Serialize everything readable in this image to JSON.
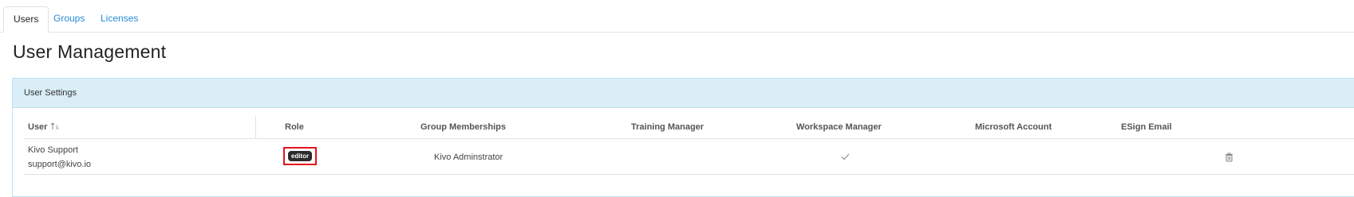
{
  "tabs": [
    {
      "label": "Users",
      "active": true
    },
    {
      "label": "Groups",
      "active": false
    },
    {
      "label": "Licenses",
      "active": false
    }
  ],
  "page": {
    "title": "User Management"
  },
  "panel": {
    "title": "User Settings"
  },
  "table": {
    "columns": [
      "User",
      "Role",
      "Group Memberships",
      "Training Manager",
      "Workspace Manager",
      "Microsoft Account",
      "ESign Email"
    ],
    "sort": {
      "column": "User",
      "direction": "ascending",
      "icon": "sort-ascending-icon"
    },
    "rows": [
      {
        "user_name": "Kivo Support",
        "user_email": "support@kivo.io",
        "role": "editor",
        "group_memberships": "Kivo Adminstrator",
        "training_manager": "",
        "workspace_manager": "check-icon",
        "microsoft_account": "",
        "esign_email": "",
        "action_icon": "trash-icon"
      }
    ]
  },
  "colors": {
    "link": "#2a8bd6",
    "panel_header_bg": "#d9eef7",
    "badge_bg": "#2b2b2b",
    "highlight": "#e3131b"
  }
}
